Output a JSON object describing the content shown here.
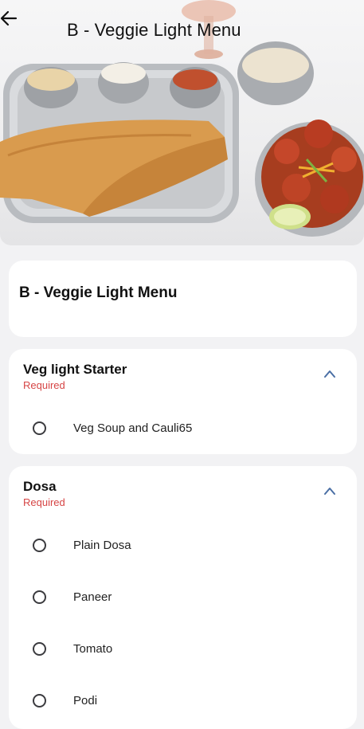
{
  "header": {
    "title": "B - Veggie Light Menu",
    "back_icon": "arrow-left-icon"
  },
  "hero": {
    "image": "south-indian-dosa-plate-photo"
  },
  "menu_card": {
    "title": "B - Veggie Light Menu"
  },
  "groups": [
    {
      "name": "Veg light Starter",
      "required_label": "Required",
      "icon": "chevron-up-icon",
      "options": [
        {
          "label": "Veg Soup and Cauli65",
          "selected": false
        }
      ]
    },
    {
      "name": "Dosa",
      "required_label": "Required",
      "icon": "chevron-up-icon",
      "options": [
        {
          "label": "Plain Dosa",
          "selected": false
        },
        {
          "label": "Paneer",
          "selected": false
        },
        {
          "label": "Tomato",
          "selected": false
        },
        {
          "label": "Podi",
          "selected": false
        }
      ]
    }
  ],
  "colors": {
    "required": "#d64545",
    "chevron": "#4a6fa5",
    "background": "#f2f2f4",
    "card": "#ffffff"
  }
}
